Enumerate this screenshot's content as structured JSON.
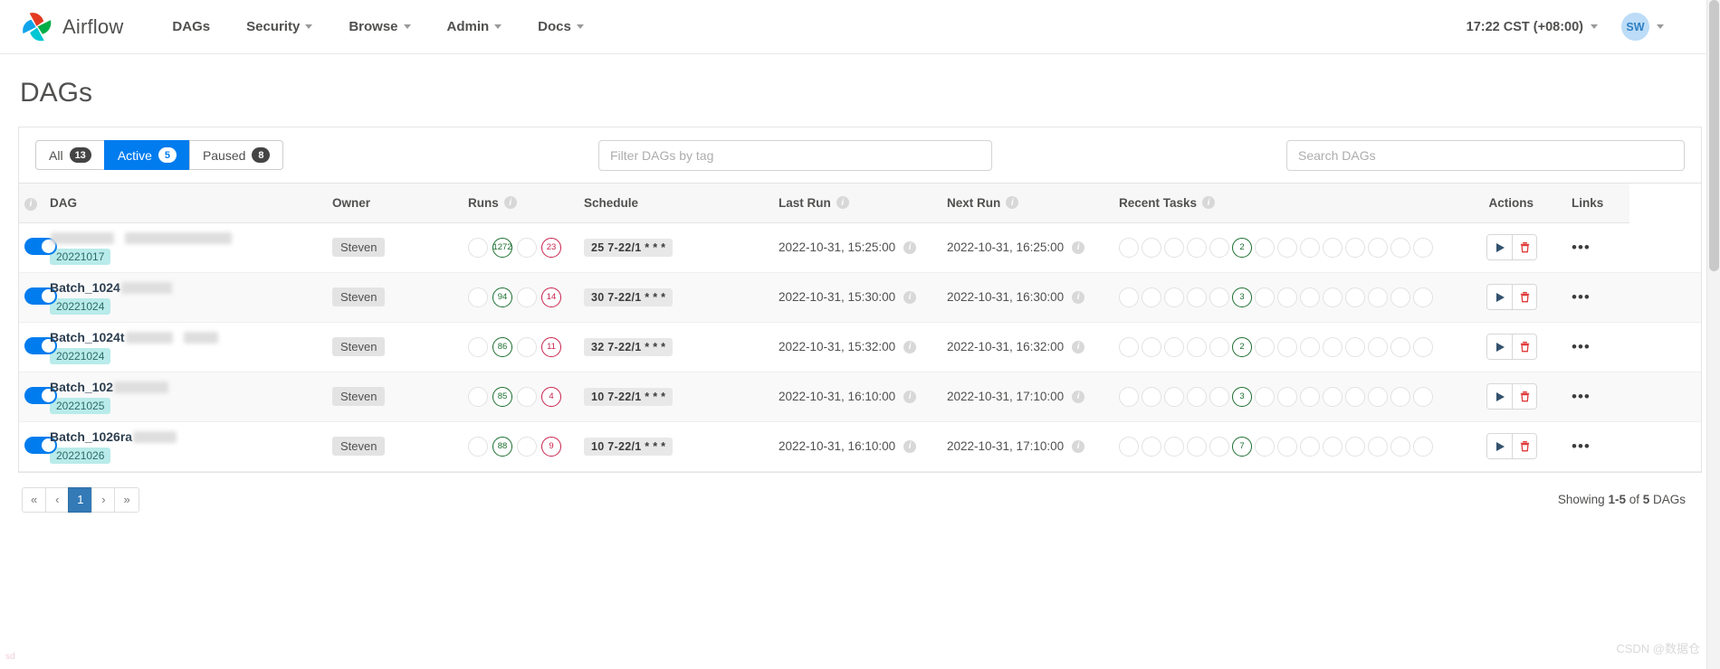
{
  "navbar": {
    "brand": "Airflow",
    "links": [
      {
        "label": "DAGs",
        "has_caret": false
      },
      {
        "label": "Security",
        "has_caret": true
      },
      {
        "label": "Browse",
        "has_caret": true
      },
      {
        "label": "Admin",
        "has_caret": true
      },
      {
        "label": "Docs",
        "has_caret": true
      }
    ],
    "time": "17:22 CST (+08:00)",
    "avatar_initials": "SW"
  },
  "page": {
    "title": "DAGs"
  },
  "filters": {
    "tabs": [
      {
        "label": "All",
        "count": "13",
        "active": false
      },
      {
        "label": "Active",
        "count": "5",
        "active": true
      },
      {
        "label": "Paused",
        "count": "8",
        "active": false
      }
    ],
    "tag_filter_placeholder": "Filter DAGs by tag",
    "tag_filter_value": "",
    "search_placeholder": "Search DAGs",
    "search_value": ""
  },
  "table": {
    "columns": [
      {
        "key": "dag",
        "label": "DAG",
        "info": true
      },
      {
        "key": "owner",
        "label": "Owner",
        "info": false
      },
      {
        "key": "runs",
        "label": "Runs",
        "info": true
      },
      {
        "key": "schedule",
        "label": "Schedule",
        "info": false
      },
      {
        "key": "last_run",
        "label": "Last Run",
        "info": true
      },
      {
        "key": "next_run",
        "label": "Next Run",
        "info": true
      },
      {
        "key": "recent_tasks",
        "label": "Recent Tasks",
        "info": true
      },
      {
        "key": "actions",
        "label": "Actions",
        "info": false
      },
      {
        "key": "links",
        "label": "Links",
        "info": false
      }
    ],
    "rows": [
      {
        "paused_toggle": "on",
        "name": "",
        "name_redacted": true,
        "tag": "20221017",
        "owner": "Steven",
        "runs": [
          {
            "value": "",
            "state": "empty"
          },
          {
            "value": "1272",
            "state": "green"
          },
          {
            "value": "",
            "state": "empty"
          },
          {
            "value": "23",
            "state": "red"
          }
        ],
        "schedule": "25 7-22/1 * * *",
        "last_run": "2022-10-31, 15:25:00",
        "next_run": "2022-10-31, 16:25:00",
        "recent_tasks_count": 14,
        "recent_tasks_filled_index": 5,
        "recent_tasks_value": "2"
      },
      {
        "paused_toggle": "on",
        "name": "Batch_1024",
        "name_redacted": true,
        "tag": "20221024",
        "owner": "Steven",
        "runs": [
          {
            "value": "",
            "state": "empty"
          },
          {
            "value": "94",
            "state": "green"
          },
          {
            "value": "",
            "state": "empty"
          },
          {
            "value": "14",
            "state": "red"
          }
        ],
        "schedule": "30 7-22/1 * * *",
        "last_run": "2022-10-31, 15:30:00",
        "next_run": "2022-10-31, 16:30:00",
        "recent_tasks_count": 14,
        "recent_tasks_filled_index": 5,
        "recent_tasks_value": "3"
      },
      {
        "paused_toggle": "on",
        "name": "Batch_1024t",
        "name_redacted": true,
        "tag": "20221024",
        "owner": "Steven",
        "runs": [
          {
            "value": "",
            "state": "empty"
          },
          {
            "value": "86",
            "state": "green"
          },
          {
            "value": "",
            "state": "empty"
          },
          {
            "value": "11",
            "state": "red"
          }
        ],
        "schedule": "32 7-22/1 * * *",
        "last_run": "2022-10-31, 15:32:00",
        "next_run": "2022-10-31, 16:32:00",
        "recent_tasks_count": 14,
        "recent_tasks_filled_index": 5,
        "recent_tasks_value": "2"
      },
      {
        "paused_toggle": "on",
        "name": "Batch_102",
        "name_redacted": true,
        "tag": "20221025",
        "owner": "Steven",
        "runs": [
          {
            "value": "",
            "state": "empty"
          },
          {
            "value": "85",
            "state": "green"
          },
          {
            "value": "",
            "state": "empty"
          },
          {
            "value": "4",
            "state": "red"
          }
        ],
        "schedule": "10 7-22/1 * * *",
        "last_run": "2022-10-31, 16:10:00",
        "next_run": "2022-10-31, 17:10:00",
        "recent_tasks_count": 14,
        "recent_tasks_filled_index": 5,
        "recent_tasks_value": "3"
      },
      {
        "paused_toggle": "on",
        "name": "Batch_1026ra",
        "name_redacted": true,
        "tag": "20221026",
        "owner": "Steven",
        "runs": [
          {
            "value": "",
            "state": "empty"
          },
          {
            "value": "88",
            "state": "green"
          },
          {
            "value": "",
            "state": "empty"
          },
          {
            "value": "9",
            "state": "red"
          }
        ],
        "schedule": "10 7-22/1 * * *",
        "last_run": "2022-10-31, 16:10:00",
        "next_run": "2022-10-31, 17:10:00",
        "recent_tasks_count": 14,
        "recent_tasks_filled_index": 5,
        "recent_tasks_value": "7"
      }
    ]
  },
  "pagination": {
    "buttons": [
      "«",
      "‹",
      "1",
      "›",
      "»"
    ],
    "active_index": 2,
    "showing_prefix": "Showing ",
    "showing_range": "1-5",
    "showing_middle": " of ",
    "showing_total": "5",
    "showing_suffix": " DAGs"
  },
  "watermark": "CSDN @数据仓",
  "corner_text": "sd",
  "colors": {
    "accent": "#017cee",
    "success": "#1b6e2e",
    "danger": "#c8234c",
    "tag_bg": "#b8ebea",
    "pager_active": "#337ab7"
  }
}
